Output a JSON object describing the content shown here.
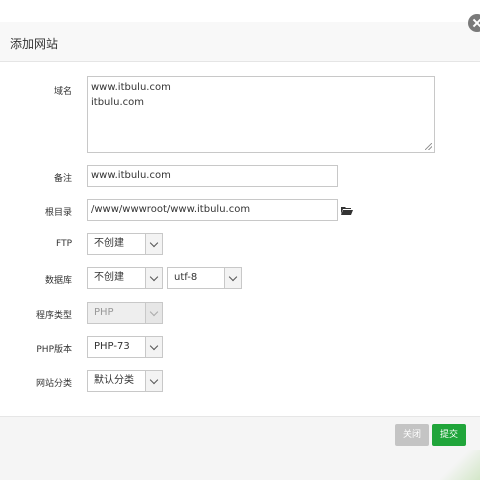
{
  "dialog": {
    "title": "添加网站"
  },
  "form": {
    "domain": {
      "label": "域名",
      "lines": [
        "www.itbulu.com",
        "itbulu.com"
      ]
    },
    "remark": {
      "label": "备注",
      "value": "www.itbulu.com"
    },
    "root_dir": {
      "label": "根目录",
      "value": "/www/wwwroot/www.itbulu.com",
      "icon": "folder-open-icon"
    },
    "ftp": {
      "label": "FTP",
      "selected": "不创建"
    },
    "database": {
      "label": "数据库",
      "selected": "不创建",
      "charset": "utf-8"
    },
    "program_type": {
      "label": "程序类型",
      "selected": "PHP",
      "disabled": true
    },
    "php_version": {
      "label": "PHP版本",
      "selected": "PHP-73"
    },
    "site_category": {
      "label": "网站分类",
      "selected": "默认分类"
    }
  },
  "footer": {
    "close_label": "关闭",
    "submit_label": "提交"
  },
  "colors": {
    "submit": "#20a53a",
    "close": "#c4c4c4"
  }
}
